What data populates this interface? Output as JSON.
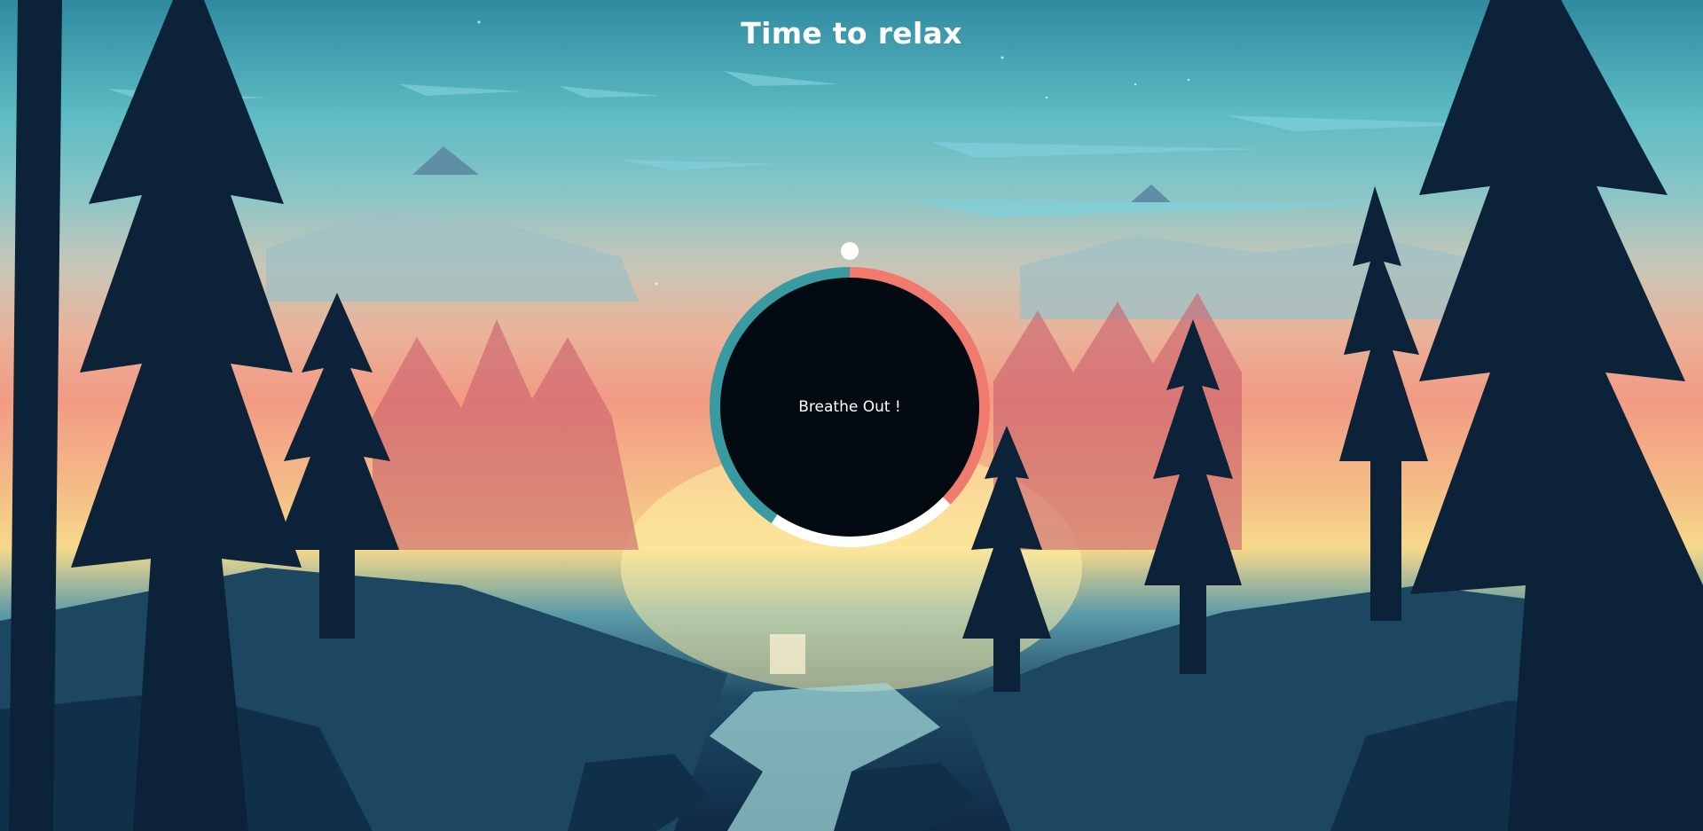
{
  "page": {
    "title": "Time to relax"
  },
  "breathing": {
    "instruction": "Breathe Out !",
    "colors": {
      "core": "#040a12",
      "ring_breathe_in": "#3a9aa2",
      "ring_breathe_out": "#f07a6e",
      "ring_hold": "#ffffff",
      "pointer": "#ffffff"
    }
  },
  "background": {
    "scene": "forest-sunset-landscape"
  }
}
